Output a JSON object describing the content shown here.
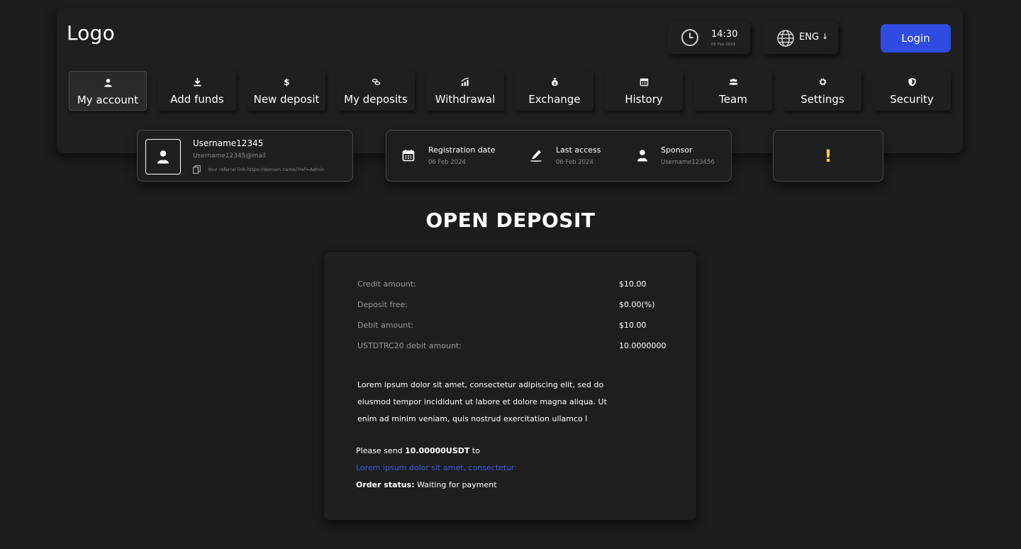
{
  "header": {
    "logo": "Logo",
    "clock": {
      "time": "14:30",
      "date": "06 Feb 2024",
      "icon": "clock-icon"
    },
    "language": {
      "label": "ENG",
      "arrow": "↓",
      "icon": "globe-icon"
    },
    "login_label": "Login",
    "accent_color": "#2f4be0"
  },
  "nav": {
    "items": [
      {
        "label": "My account",
        "icon": "user-icon",
        "active": true
      },
      {
        "label": "Add funds",
        "icon": "download-icon"
      },
      {
        "label": "New deposit",
        "icon": "dollar-icon"
      },
      {
        "label": "My deposits",
        "icon": "coins-icon"
      },
      {
        "label": "Withdrawal",
        "icon": "chart-up-icon"
      },
      {
        "label": "Exchange",
        "icon": "money-bag-icon"
      },
      {
        "label": "History",
        "icon": "calendar-icon"
      },
      {
        "label": "Team",
        "icon": "team-icon"
      },
      {
        "label": "Settings",
        "icon": "gear-icon"
      },
      {
        "label": "Security",
        "icon": "shield-icon"
      }
    ]
  },
  "user": {
    "username": "Username12345",
    "email": "Username12345@mail",
    "referral": "Your referral link:https://domain.name/?ref=Admin"
  },
  "info": {
    "registration": {
      "title": "Registration date",
      "value": "06 Feb 2024"
    },
    "last_access": {
      "title": "Last access",
      "value": "06 Feb 2024"
    },
    "sponsor": {
      "title": "Sponsor",
      "value": "Username123456"
    }
  },
  "alert": {
    "mark": "!",
    "color": "#f2d23c"
  },
  "page_title": "OPEN DEPOSIT",
  "deposit": {
    "rows": [
      {
        "label": "Credit amount:",
        "value": "$10.00"
      },
      {
        "label": "Deposit free:",
        "value": "$0.00(%)"
      },
      {
        "label": "Debit amount:",
        "value": "$10.00"
      },
      {
        "label": "USTDTRC20 debit amount:",
        "value": "10.0000000"
      }
    ],
    "description": "Lorem ipsum dolor sit amet, consectetur adipiscing elit, sed do eiusmod tempor incididunt ut labore et dolore magna aliqua. Ut enim ad minim veniam, quis nostrud exercitation ullamco l",
    "send_prefix": "Please send ",
    "send_amount": "10.00000USDT",
    "send_suffix": " to",
    "wallet_link": "Lorem ipsum dolor sit amet, consectetur",
    "status_label": "Order status:",
    "status_value": " Waiting for payment"
  }
}
